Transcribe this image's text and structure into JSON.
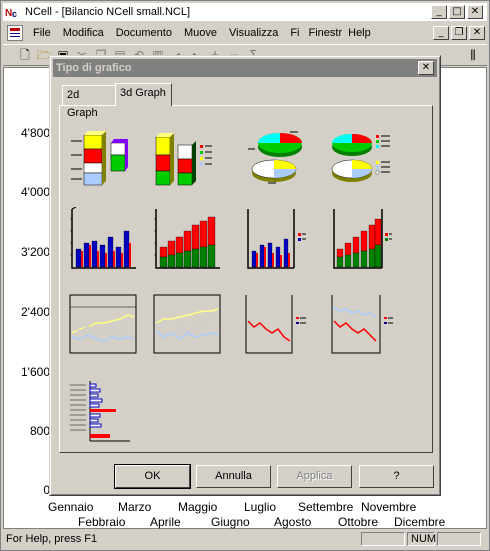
{
  "app": {
    "title": "NCell - [Bilancio NCell small.NCL]",
    "colors": {
      "title_bg": "#ffffff",
      "dialog_title_bg": "#808080",
      "face": "#d4d0c8"
    }
  },
  "window_controls": {
    "minimize": "_",
    "maximize": "□",
    "close": "✕"
  },
  "mdi_controls": {
    "minimize": "_",
    "restore": "❐",
    "close": "✕"
  },
  "menu": [
    "File",
    "Modifica",
    "Documento",
    "Muove",
    "Visualizza",
    "Fi",
    "Finestr",
    "Help"
  ],
  "toolbar_icons": [
    "new-icon",
    "open-icon",
    "save-icon",
    "cut-icon",
    "copy-icon",
    "paste-icon",
    "undo-icon",
    "chart-icon",
    "arrow-left-icon",
    "arrow-right-icon",
    "plus-icon",
    "minus-icon",
    "sum-icon"
  ],
  "sheet": {
    "y_ticks": [
      "4'800",
      "4'000",
      "3'200",
      "2'400",
      "1'600",
      "800",
      "0"
    ],
    "x_labels_top": [
      "Gennaio",
      "Marzo",
      "Maggio",
      "Luglio",
      "Settembre",
      "Novembre"
    ],
    "x_labels_bottom": [
      "Febbraio",
      "Aprile",
      "Giugno",
      "Agosto",
      "Ottobre",
      "Dicembre"
    ]
  },
  "dialog": {
    "title": "Tipo di grafico",
    "close": "✕",
    "tabs": [
      "2d Graph",
      "3d Graph"
    ],
    "active_tab": "3d Graph",
    "thumbnails": [
      "3d-stacked-bar-labeled",
      "3d-stacked-bar-legend",
      "3d-pie-labeled",
      "3d-pie-legend",
      "3d-bar-blue",
      "3d-bar-stacked",
      "3d-bar-blue-legend",
      "3d-bar-stacked-legend",
      "line-chart",
      "line-chart-grid",
      "line-chart-red-legend",
      "line-chart-multi-legend",
      "horizontal-bar-chart"
    ],
    "buttons": {
      "ok": "OK",
      "cancel": "Annulla",
      "apply": "Applica",
      "help": "?"
    }
  },
  "status": {
    "text": "For Help, press F1",
    "num": "NUM"
  }
}
